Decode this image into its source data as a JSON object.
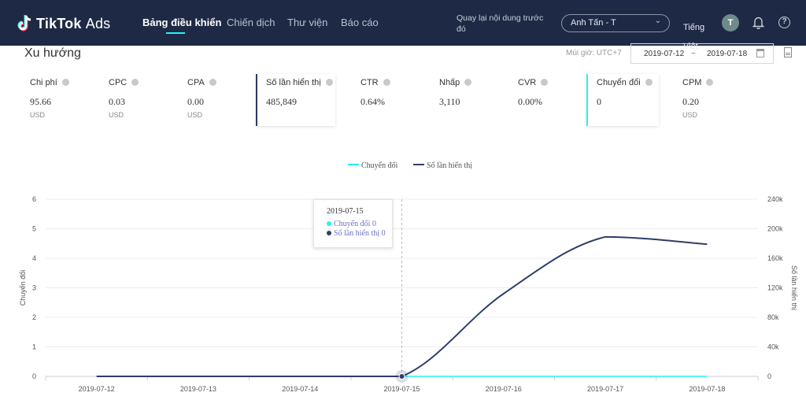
{
  "brand": {
    "name": "TikTok",
    "suffix": "Ads"
  },
  "nav": {
    "items": [
      {
        "label": "Bảng điều khiển",
        "active": true
      },
      {
        "label": "Chiến dịch",
        "active": false
      },
      {
        "label": "Thư viện",
        "active": false
      },
      {
        "label": "Báo cáo",
        "active": false
      }
    ]
  },
  "header": {
    "back_link": "Quay lại nội dung trước đó",
    "account": "Anh Tấn - T",
    "language": "Tiếng Việt",
    "avatar_initial": "T"
  },
  "trend": {
    "title": "Xu hướng",
    "timezone": "Múi giờ: UTC+7",
    "date_start": "2019-07-12",
    "date_separator": "~",
    "date_end": "2019-07-18"
  },
  "metrics": [
    {
      "label": "Chi phí",
      "value": "95.66",
      "unit": "USD"
    },
    {
      "label": "CPC",
      "value": "0.03",
      "unit": "USD"
    },
    {
      "label": "CPA",
      "value": "0.00",
      "unit": "USD"
    },
    {
      "label": "Số lần hiển thị",
      "value": "485,849",
      "unit": "",
      "selected": true,
      "color": "#2b3a67"
    },
    {
      "label": "CTR",
      "value": "0.64%",
      "unit": ""
    },
    {
      "label": "Nhấp",
      "value": "3,110",
      "unit": ""
    },
    {
      "label": "CVR",
      "value": "0.00%",
      "unit": ""
    },
    {
      "label": "Chuyển đổi",
      "value": "0",
      "unit": "",
      "selected": true,
      "color": "#25f4ee"
    },
    {
      "label": "CPM",
      "value": "0.20",
      "unit": "USD"
    }
  ],
  "colors": {
    "conversions": "#25f4ee",
    "impressions": "#2e3d6b",
    "nav_bg": "#1e2a45"
  },
  "chart_data": {
    "type": "line",
    "x": [
      "2019-07-12",
      "2019-07-13",
      "2019-07-14",
      "2019-07-15",
      "2019-07-16",
      "2019-07-17",
      "2019-07-18"
    ],
    "series": [
      {
        "name": "Chuyển đổi",
        "axis": "left",
        "values": [
          0,
          0,
          0,
          0,
          0,
          0,
          0
        ]
      },
      {
        "name": "Số lần hiển thị",
        "axis": "right",
        "values": [
          0,
          0,
          0,
          0,
          112000,
          189000,
          179000
        ]
      }
    ],
    "ylabel_left": "Chuyển đổi",
    "ylabel_right": "Số lần hiển thị",
    "ylim_left": [
      0,
      6
    ],
    "yticks_left": [
      "0",
      "1",
      "2",
      "3",
      "4",
      "5",
      "6"
    ],
    "ylim_right": [
      0,
      240000
    ],
    "yticks_right": [
      "0",
      "40k",
      "80k",
      "120k",
      "160k",
      "200k",
      "240k"
    ],
    "legend_position": "top-center",
    "grid": true,
    "tooltip": {
      "date": "2019-07-15",
      "rows": [
        {
          "label": "Chuyển đổi",
          "value": "0"
        },
        {
          "label": "Số lần hiển thị",
          "value": "0"
        }
      ]
    }
  }
}
